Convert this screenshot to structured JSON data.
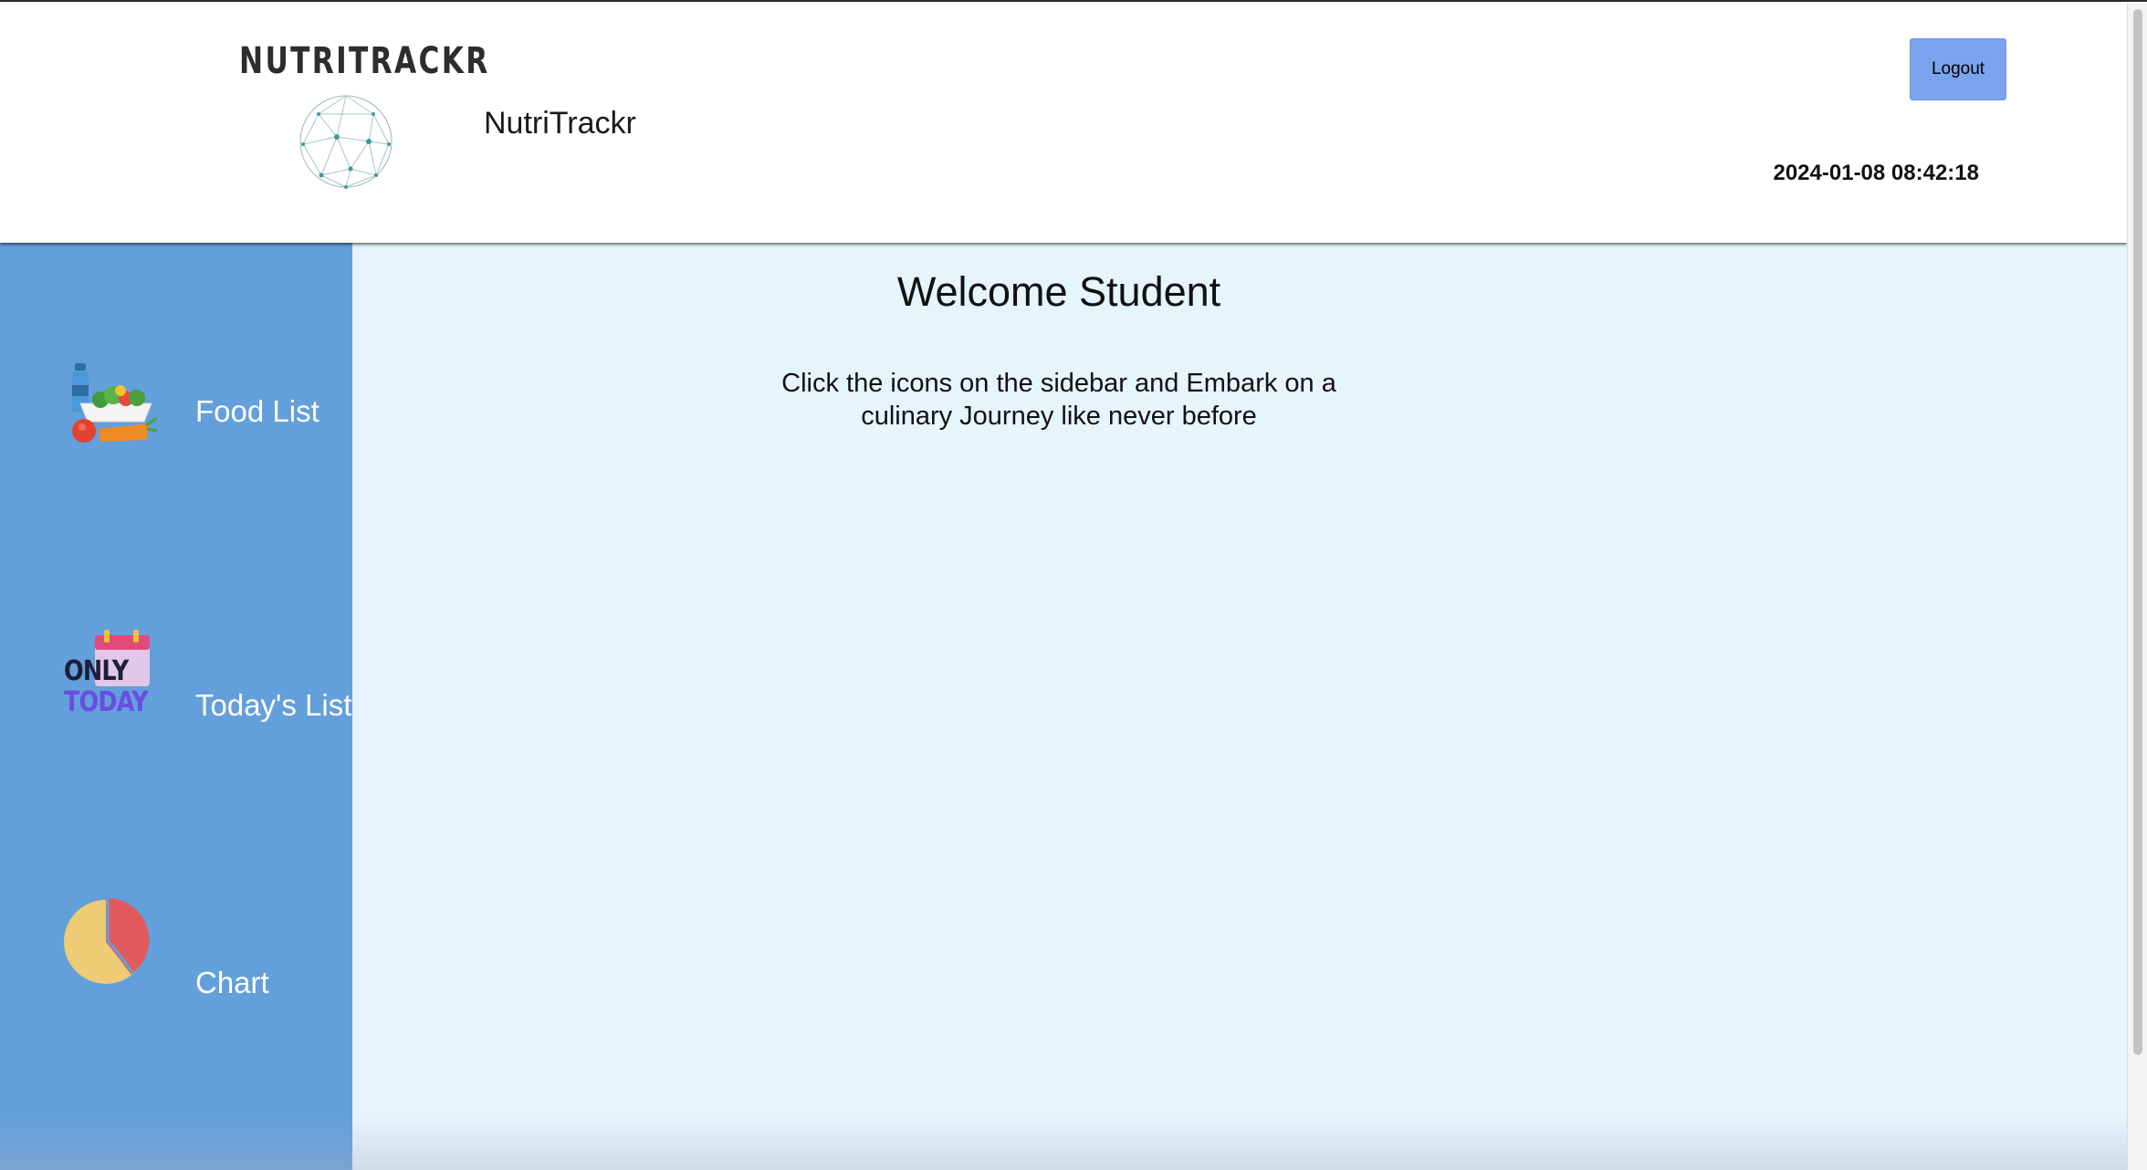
{
  "header": {
    "logo_text": "NUTRITRACKR",
    "app_name": "NutriTrackr",
    "logout_label": "Logout",
    "datetime": "2024-01-08 08:42:18"
  },
  "sidebar": {
    "items": [
      {
        "label": "Food List",
        "icon": "food-basket-icon"
      },
      {
        "label": "Today's List",
        "icon": "only-today-calendar-icon",
        "icon_text_top": "ONLY",
        "icon_text_bottom": "TODAY"
      },
      {
        "label": "Chart",
        "icon": "pie-chart-icon"
      }
    ]
  },
  "main": {
    "welcome": "Welcome Student",
    "tagline": "Click the icons on the sidebar and Embark on a culinary Journey like never before"
  },
  "colors": {
    "sidebar_bg": "#639fdb",
    "main_bg": "#e6f4fc",
    "logout_bg": "#7aa4ee"
  }
}
